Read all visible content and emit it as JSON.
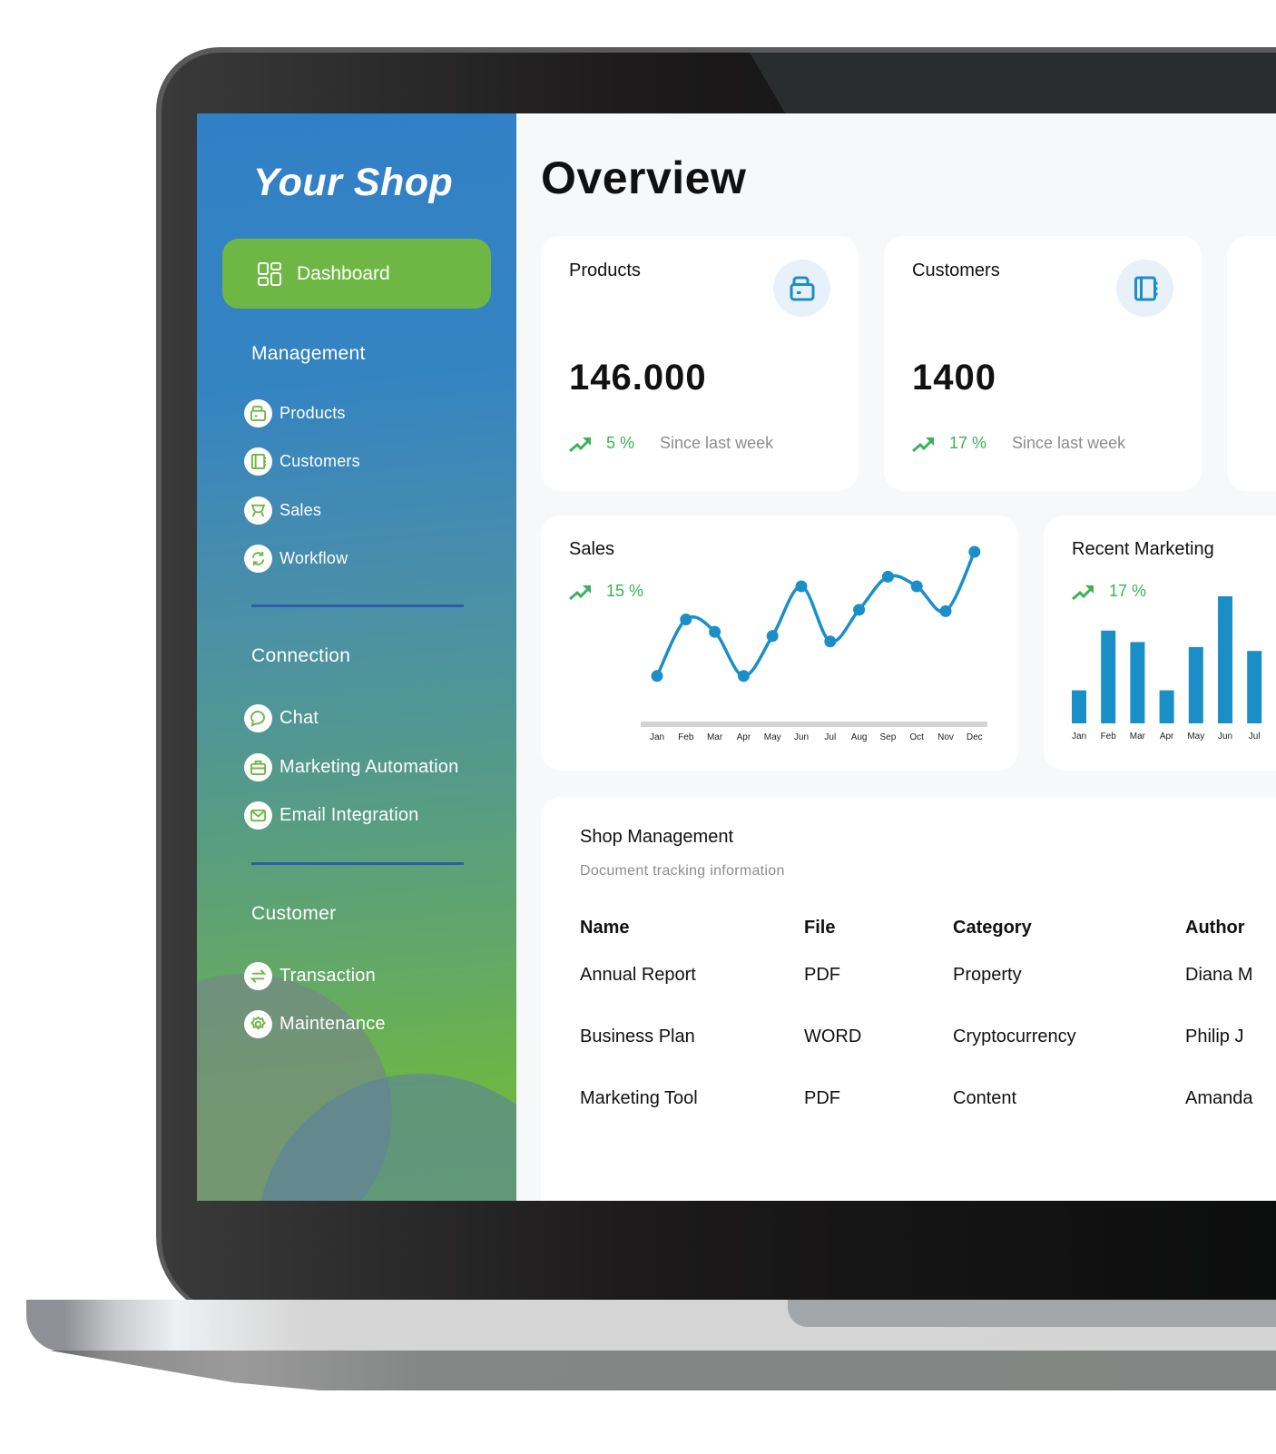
{
  "app": {
    "brand": "Your Shop",
    "page_title": "Overview"
  },
  "colors": {
    "accent_green": "#6fb744",
    "accent_blue": "#1a8fc7",
    "trend_green": "#3bb15a",
    "divider_blue": "#2a5ea6"
  },
  "sidebar": {
    "dashboard": {
      "label": "Dashboard",
      "icon": "grid-icon",
      "active": true
    },
    "sections": [
      {
        "title": "Management",
        "items": [
          {
            "label": "Products",
            "icon": "folder-icon"
          },
          {
            "label": "Customers",
            "icon": "notebook-icon"
          },
          {
            "label": "Sales",
            "icon": "cart-icon"
          },
          {
            "label": "Workflow",
            "icon": "refresh-icon"
          }
        ]
      },
      {
        "title": "Connection",
        "items": [
          {
            "label": "Chat",
            "icon": "chat-icon"
          },
          {
            "label": "Marketing Automation",
            "icon": "briefcase-icon"
          },
          {
            "label": "Email Integration",
            "icon": "mail-icon"
          }
        ]
      },
      {
        "title": "Customer",
        "items": [
          {
            "label": "Transaction",
            "icon": "swap-icon"
          },
          {
            "label": "Maintenance",
            "icon": "gear-icon"
          }
        ]
      }
    ]
  },
  "stats": [
    {
      "title": "Products",
      "value": "146.000",
      "change": "5 %",
      "since": "Since last week",
      "icon": "folder-icon"
    },
    {
      "title": "Customers",
      "value": "1400",
      "change": "17 %",
      "since": "Since last week",
      "icon": "notebook-icon"
    }
  ],
  "chart_data": [
    {
      "type": "line",
      "title": "Sales",
      "change": "15 %",
      "categories": [
        "Jan",
        "Feb",
        "Mar",
        "Apr",
        "May",
        "Jun",
        "Jul",
        "Aug",
        "Sep",
        "Oct",
        "Nov",
        "Dec"
      ],
      "values": [
        10,
        51,
        42,
        10,
        39,
        75,
        35,
        58,
        82,
        75,
        57,
        100
      ],
      "xlabel": "",
      "ylabel": "",
      "ylim": [
        0,
        100
      ],
      "grid": false,
      "smooth": true
    },
    {
      "type": "bar",
      "title": "Recent Marketing",
      "change": "17 %",
      "categories": [
        "Jan",
        "Feb",
        "Mar",
        "Apr",
        "May",
        "Jun",
        "Jul"
      ],
      "values": [
        26,
        73,
        64,
        26,
        60,
        100,
        57
      ],
      "xlabel": "",
      "ylabel": "",
      "ylim": [
        0,
        100
      ],
      "grid": false
    }
  ],
  "table": {
    "title": "Shop Management",
    "subtitle": "Document tracking information",
    "columns": [
      "Name",
      "File",
      "Category",
      "Author"
    ],
    "rows": [
      [
        "Annual Report",
        "PDF",
        "Property",
        "Diana M"
      ],
      [
        "Business Plan",
        "WORD",
        "Cryptocurrency",
        "Philip J"
      ],
      [
        "Marketing Tool",
        "PDF",
        "Content",
        "Amanda"
      ]
    ]
  }
}
